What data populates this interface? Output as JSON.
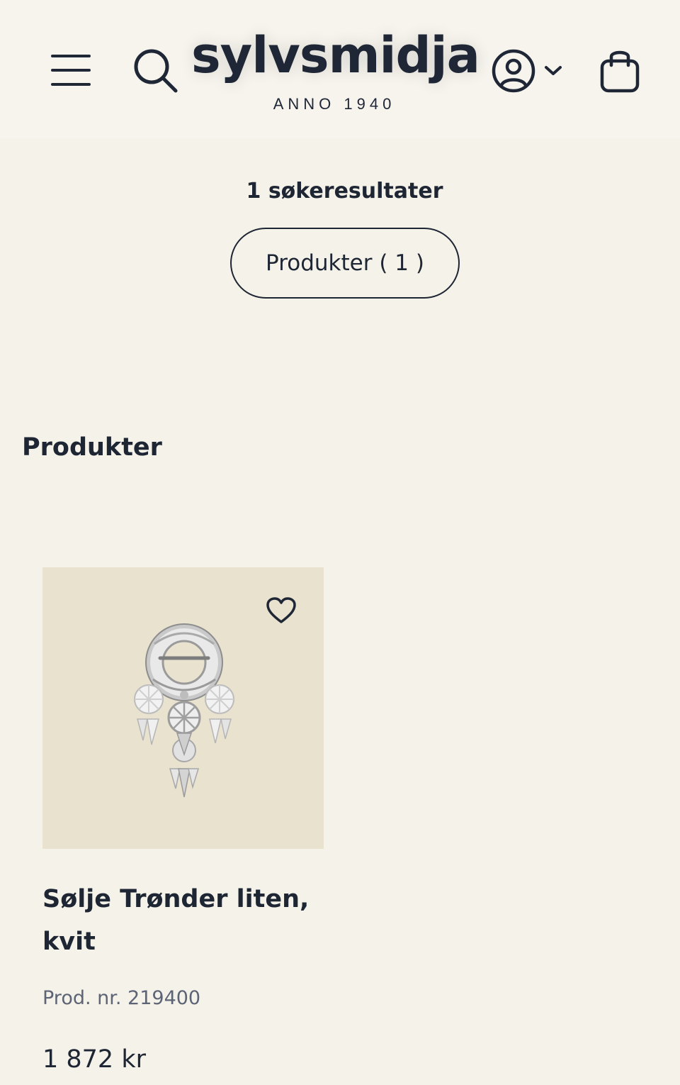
{
  "header": {
    "logo_text": "sylvsmidja",
    "logo_tagline": "ANNO 1940",
    "menu_icon": "hamburger-menu-icon",
    "search_icon": "search-icon",
    "account_icon": "user-circle-icon",
    "account_dropdown_icon": "chevron-down-icon",
    "cart_icon": "shopping-bag-icon"
  },
  "search": {
    "results_count": "1 søkeresultater",
    "filters": [
      {
        "label": "Produkter ( 1 )"
      }
    ]
  },
  "products_section": {
    "title": "Produkter",
    "items": [
      {
        "name": "Sølje Trønder liten, kvit",
        "product_number": "Prod. nr. 219400",
        "price": "1 872 kr",
        "favorite_icon": "heart-icon",
        "image_icon": "brooch-image"
      }
    ]
  },
  "colors": {
    "background": "#f4f2e9",
    "text": "#1e2533",
    "muted_text": "#5d6475",
    "image_background": "#e8e2cf"
  }
}
